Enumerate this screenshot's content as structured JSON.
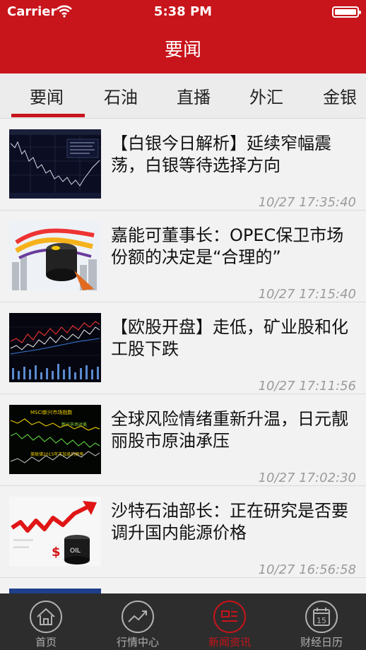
{
  "status": {
    "carrier": "Carrier",
    "time": "5:38 PM"
  },
  "header": {
    "title": "要闻"
  },
  "tabs": [
    {
      "label": "要闻",
      "active": true
    },
    {
      "label": "石油"
    },
    {
      "label": "直播"
    },
    {
      "label": "外汇"
    },
    {
      "label": "金银"
    }
  ],
  "news": [
    {
      "title": "【白银今日解析】延续窄幅震荡，白银等待选择方向",
      "time": "10/27 17:35:40"
    },
    {
      "title": "嘉能可董事长：OPEC保卫市场份额的决定是“合理的”",
      "time": "10/27 17:15:40"
    },
    {
      "title": "【欧股开盘】走低，矿业股和化工股下跌",
      "time": "10/27 17:11:56"
    },
    {
      "title": "全球风险情绪重新升温，日元靓丽股市原油承压",
      "time": "10/27 17:02:30"
    },
    {
      "title": "沙特石油部长：正在研究是否要调升国内能源价格",
      "time": "10/27 16:56:58"
    },
    {
      "title": "",
      "time": ""
    }
  ],
  "thumb_text": {
    "chart4_title": "MSCI新兴市场指数",
    "chart4_legend": "新兴市场对美",
    "chart4_note": "美联储2015年不加息的概率",
    "oil_label": "OIL"
  },
  "tabbar": [
    {
      "label": "首页",
      "icon": "home-icon"
    },
    {
      "label": "行情中心",
      "icon": "market-chart-icon"
    },
    {
      "label": "新闻资讯",
      "icon": "news-icon",
      "active": true
    },
    {
      "label": "财经日历",
      "icon": "calendar-icon",
      "calendar_day": "15"
    }
  ],
  "colors": {
    "brand_red": "#c8141b",
    "tabbar_bg": "#2d2d2d",
    "timestamp_gray": "#9b9b9b"
  }
}
